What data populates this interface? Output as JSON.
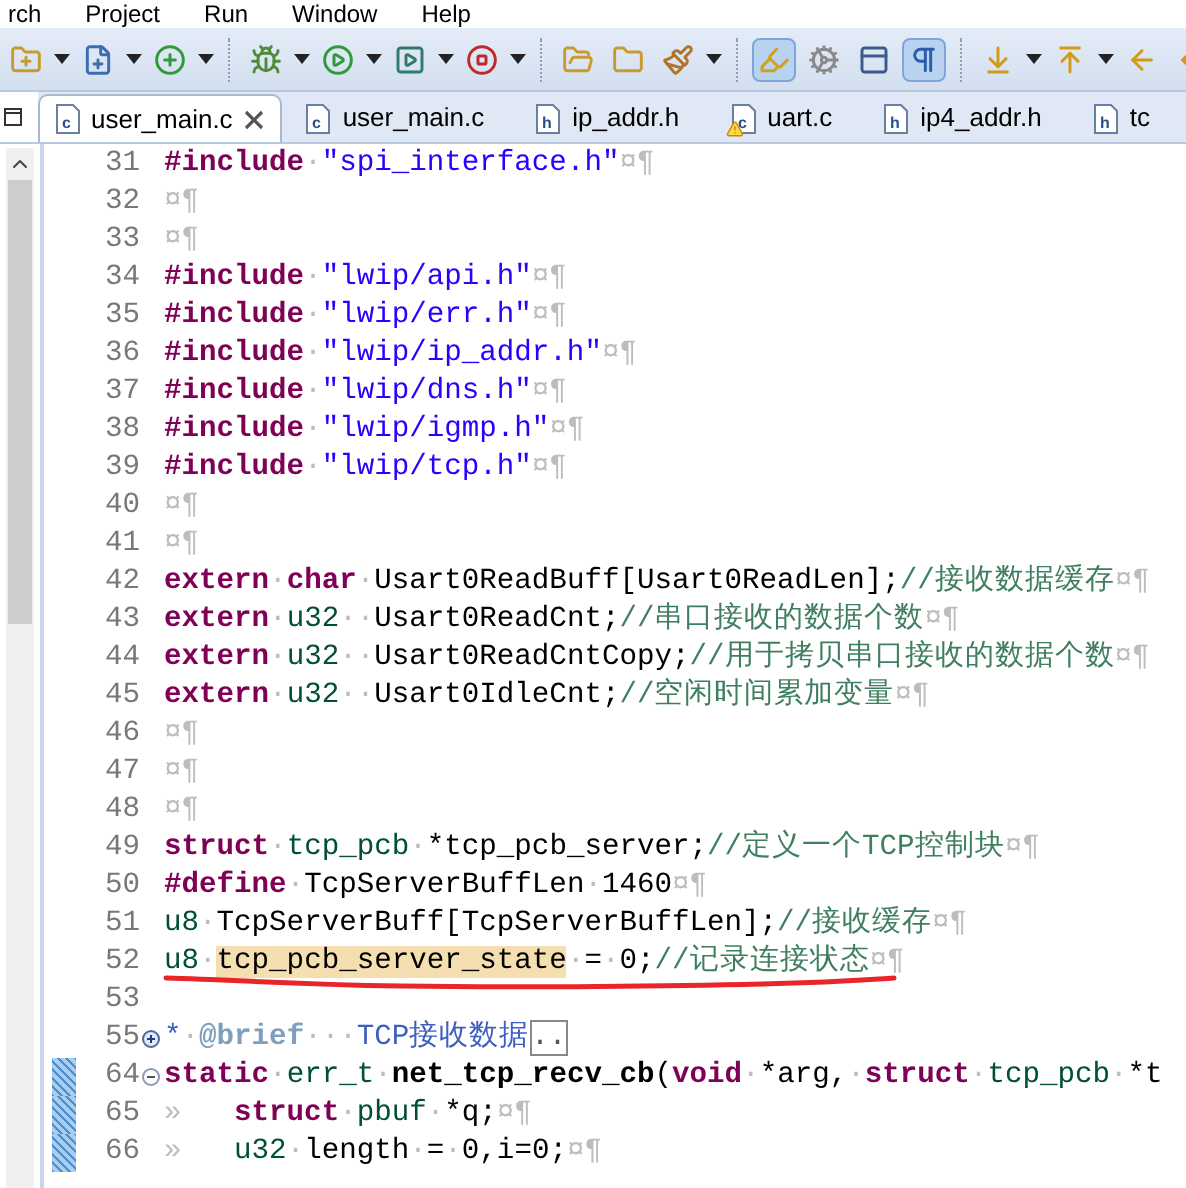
{
  "menu": [
    "rch",
    "Project",
    "Run",
    "Window",
    "Help"
  ],
  "toolbar": [
    {
      "kind": "new-folder",
      "dropdown": true,
      "pressed": false
    },
    {
      "kind": "new-file",
      "dropdown": true,
      "pressed": false
    },
    {
      "kind": "new-class",
      "dropdown": true,
      "pressed": false
    },
    {
      "kind": "separator"
    },
    {
      "kind": "debug",
      "dropdown": true,
      "pressed": false
    },
    {
      "kind": "run",
      "dropdown": true,
      "pressed": false
    },
    {
      "kind": "run-config",
      "dropdown": true,
      "pressed": false
    },
    {
      "kind": "run-stop",
      "dropdown": true,
      "pressed": false
    },
    {
      "kind": "separator"
    },
    {
      "kind": "open-folder",
      "dropdown": false,
      "pressed": false
    },
    {
      "kind": "folder",
      "dropdown": false,
      "pressed": false
    },
    {
      "kind": "brush",
      "dropdown": true,
      "pressed": false
    },
    {
      "kind": "separator"
    },
    {
      "kind": "highlighter",
      "dropdown": false,
      "pressed": true
    },
    {
      "kind": "cog",
      "dropdown": false,
      "pressed": false
    },
    {
      "kind": "panel",
      "dropdown": false,
      "pressed": false
    },
    {
      "kind": "pilcrow",
      "dropdown": false,
      "pressed": true
    },
    {
      "kind": "separator"
    },
    {
      "kind": "next",
      "dropdown": true,
      "pressed": false
    },
    {
      "kind": "prev",
      "dropdown": true,
      "pressed": false
    },
    {
      "kind": "back-star",
      "dropdown": false,
      "pressed": false
    },
    {
      "kind": "back",
      "dropdown": false,
      "pressed": false
    }
  ],
  "tabs": [
    {
      "label": "user_main.c",
      "kind": "c",
      "selected": true,
      "warning": false
    },
    {
      "label": "user_main.c",
      "kind": "c",
      "selected": false,
      "warning": false
    },
    {
      "label": "ip_addr.h",
      "kind": "h",
      "selected": false,
      "warning": false
    },
    {
      "label": "uart.c",
      "kind": "c",
      "selected": false,
      "warning": true
    },
    {
      "label": "ip4_addr.h",
      "kind": "h",
      "selected": false,
      "warning": false
    },
    {
      "label": "tc",
      "kind": "h",
      "selected": false,
      "warning": false
    }
  ],
  "lines": [
    {
      "number": "31",
      "tokens": [
        {
          "kind": "kw",
          "text": "#include"
        },
        {
          "kind": "ws",
          "text": "·"
        },
        {
          "kind": "str",
          "text": "\"spi_interface.h\""
        },
        {
          "kind": "ws",
          "text": "¤¶"
        }
      ]
    },
    {
      "number": "32",
      "tokens": [
        {
          "kind": "ws",
          "text": "¤¶"
        }
      ]
    },
    {
      "number": "33",
      "tokens": [
        {
          "kind": "ws",
          "text": "¤¶"
        }
      ]
    },
    {
      "number": "34",
      "tokens": [
        {
          "kind": "kw",
          "text": "#include"
        },
        {
          "kind": "ws",
          "text": "·"
        },
        {
          "kind": "str",
          "text": "\"lwip/api.h\""
        },
        {
          "kind": "ws",
          "text": "¤¶"
        }
      ]
    },
    {
      "number": "35",
      "tokens": [
        {
          "kind": "kw",
          "text": "#include"
        },
        {
          "kind": "ws",
          "text": "·"
        },
        {
          "kind": "str",
          "text": "\"lwip/err.h\""
        },
        {
          "kind": "ws",
          "text": "¤¶"
        }
      ]
    },
    {
      "number": "36",
      "tokens": [
        {
          "kind": "kw",
          "text": "#include"
        },
        {
          "kind": "ws",
          "text": "·"
        },
        {
          "kind": "str",
          "text": "\"lwip/ip_addr.h\""
        },
        {
          "kind": "ws",
          "text": "¤¶"
        }
      ]
    },
    {
      "number": "37",
      "tokens": [
        {
          "kind": "kw",
          "text": "#include"
        },
        {
          "kind": "ws",
          "text": "·"
        },
        {
          "kind": "str",
          "text": "\"lwip/dns.h\""
        },
        {
          "kind": "ws",
          "text": "¤¶"
        }
      ]
    },
    {
      "number": "38",
      "tokens": [
        {
          "kind": "kw",
          "text": "#include"
        },
        {
          "kind": "ws",
          "text": "·"
        },
        {
          "kind": "str",
          "text": "\"lwip/igmp.h\""
        },
        {
          "kind": "ws",
          "text": "¤¶"
        }
      ]
    },
    {
      "number": "39",
      "tokens": [
        {
          "kind": "kw",
          "text": "#include"
        },
        {
          "kind": "ws",
          "text": "·"
        },
        {
          "kind": "str",
          "text": "\"lwip/tcp.h\""
        },
        {
          "kind": "ws",
          "text": "¤¶"
        }
      ]
    },
    {
      "number": "40",
      "tokens": [
        {
          "kind": "ws",
          "text": "¤¶"
        }
      ]
    },
    {
      "number": "41",
      "tokens": [
        {
          "kind": "ws",
          "text": "¤¶"
        }
      ]
    },
    {
      "number": "42",
      "tokens": [
        {
          "kind": "kw",
          "text": "extern"
        },
        {
          "kind": "ws",
          "text": "·"
        },
        {
          "kind": "kw",
          "text": "char"
        },
        {
          "kind": "ws",
          "text": "·"
        },
        {
          "kind": "plain",
          "text": "Usart0ReadBuff[Usart0ReadLen];"
        },
        {
          "kind": "cmt",
          "text": "//接收数据缓存"
        },
        {
          "kind": "ws",
          "text": "¤¶"
        }
      ]
    },
    {
      "number": "43",
      "tokens": [
        {
          "kind": "kw",
          "text": "extern"
        },
        {
          "kind": "ws",
          "text": "·"
        },
        {
          "kind": "type",
          "text": "u32"
        },
        {
          "kind": "ws",
          "text": "··"
        },
        {
          "kind": "plain",
          "text": "Usart0ReadCnt;"
        },
        {
          "kind": "cmt",
          "text": "//串口接收的数据个数"
        },
        {
          "kind": "ws",
          "text": "¤¶"
        }
      ]
    },
    {
      "number": "44",
      "tokens": [
        {
          "kind": "kw",
          "text": "extern"
        },
        {
          "kind": "ws",
          "text": "·"
        },
        {
          "kind": "type",
          "text": "u32"
        },
        {
          "kind": "ws",
          "text": "··"
        },
        {
          "kind": "plain",
          "text": "Usart0ReadCntCopy;"
        },
        {
          "kind": "cmt",
          "text": "//用于拷贝串口接收的数据个数"
        },
        {
          "kind": "ws",
          "text": "¤¶"
        }
      ]
    },
    {
      "number": "45",
      "tokens": [
        {
          "kind": "kw",
          "text": "extern"
        },
        {
          "kind": "ws",
          "text": "·"
        },
        {
          "kind": "type",
          "text": "u32"
        },
        {
          "kind": "ws",
          "text": "··"
        },
        {
          "kind": "plain",
          "text": "Usart0IdleCnt;"
        },
        {
          "kind": "cmt",
          "text": "//空闲时间累加变量"
        },
        {
          "kind": "ws",
          "text": "¤¶"
        }
      ]
    },
    {
      "number": "46",
      "tokens": [
        {
          "kind": "ws",
          "text": "¤¶"
        }
      ]
    },
    {
      "number": "47",
      "tokens": [
        {
          "kind": "ws",
          "text": "¤¶"
        }
      ]
    },
    {
      "number": "48",
      "tokens": [
        {
          "kind": "ws",
          "text": "¤¶"
        }
      ]
    },
    {
      "number": "49",
      "tokens": [
        {
          "kind": "kw",
          "text": "struct"
        },
        {
          "kind": "ws",
          "text": "·"
        },
        {
          "kind": "type",
          "text": "tcp_pcb"
        },
        {
          "kind": "ws",
          "text": "·"
        },
        {
          "kind": "plain",
          "text": "*tcp_pcb_server;"
        },
        {
          "kind": "cmt",
          "text": "//定义一个TCP控制块"
        },
        {
          "kind": "ws",
          "text": "¤¶"
        }
      ]
    },
    {
      "number": "50",
      "tokens": [
        {
          "kind": "kw",
          "text": "#define"
        },
        {
          "kind": "ws",
          "text": "·"
        },
        {
          "kind": "plain",
          "text": "TcpServerBuffLen"
        },
        {
          "kind": "ws",
          "text": "·"
        },
        {
          "kind": "plain",
          "text": "1460"
        },
        {
          "kind": "ws",
          "text": "¤¶"
        }
      ]
    },
    {
      "number": "51",
      "tokens": [
        {
          "kind": "type",
          "text": "u8"
        },
        {
          "kind": "ws",
          "text": "·"
        },
        {
          "kind": "plain",
          "text": "TcpServerBuff[TcpServerBuffLen];"
        },
        {
          "kind": "cmt",
          "text": "//接收缓存"
        },
        {
          "kind": "ws",
          "text": "¤¶"
        }
      ]
    },
    {
      "number": "52",
      "underlined": true,
      "tokens": [
        {
          "kind": "type",
          "text": "u8"
        },
        {
          "kind": "ws",
          "text": "·"
        },
        {
          "kind": "hl",
          "text": "tcp_pcb_server_state"
        },
        {
          "kind": "ws",
          "text": "·"
        },
        {
          "kind": "plain",
          "text": "="
        },
        {
          "kind": "ws",
          "text": "·"
        },
        {
          "kind": "plain",
          "text": "0;"
        },
        {
          "kind": "cmt",
          "text": "//记录连接状态"
        },
        {
          "kind": "ws",
          "text": "¤¶"
        }
      ]
    },
    {
      "number": "53"
    },
    {
      "number": "55",
      "collapsed": true,
      "tokens": [
        {
          "kind": "doc",
          "text": "*"
        },
        {
          "kind": "ws",
          "text": "·"
        },
        {
          "kind": "tag",
          "text": "@brief"
        },
        {
          "kind": "ws",
          "text": "···"
        },
        {
          "kind": "doc",
          "text": "TCP接收数据"
        },
        {
          "kind": "more",
          "text": ".."
        }
      ]
    },
    {
      "number": "64",
      "collapsed": false,
      "changed": true,
      "tokens": [
        {
          "kind": "kw",
          "text": "static"
        },
        {
          "kind": "ws",
          "text": "·"
        },
        {
          "kind": "type",
          "text": "err_t"
        },
        {
          "kind": "ws",
          "text": "·"
        },
        {
          "kind": "fn",
          "text": "net_tcp_recv_cb"
        },
        {
          "kind": "plain",
          "text": "("
        },
        {
          "kind": "kw",
          "text": "void"
        },
        {
          "kind": "ws",
          "text": "·"
        },
        {
          "kind": "plain",
          "text": "*arg,"
        },
        {
          "kind": "ws",
          "text": "·"
        },
        {
          "kind": "kw",
          "text": "struct"
        },
        {
          "kind": "ws",
          "text": "·"
        },
        {
          "kind": "type",
          "text": "tcp_pcb"
        },
        {
          "kind": "ws",
          "text": "·"
        },
        {
          "kind": "plain",
          "text": "*t"
        }
      ]
    },
    {
      "number": "65",
      "changed": true,
      "tokens": [
        {
          "kind": "ws",
          "text": "»   "
        },
        {
          "kind": "kw",
          "text": "struct"
        },
        {
          "kind": "ws",
          "text": "·"
        },
        {
          "kind": "type",
          "text": "pbuf"
        },
        {
          "kind": "ws",
          "text": "·"
        },
        {
          "kind": "plain",
          "text": "*q;"
        },
        {
          "kind": "ws",
          "text": "¤¶"
        }
      ]
    },
    {
      "number": "66",
      "changed": true,
      "tokens": [
        {
          "kind": "ws",
          "text": "»   "
        },
        {
          "kind": "type",
          "text": "u32"
        },
        {
          "kind": "ws",
          "text": "·"
        },
        {
          "kind": "plain",
          "text": "length"
        },
        {
          "kind": "ws",
          "text": "·"
        },
        {
          "kind": "plain",
          "text": "="
        },
        {
          "kind": "ws",
          "text": "·"
        },
        {
          "kind": "plain",
          "text": "0,i=0;"
        },
        {
          "kind": "ws",
          "text": "¤¶"
        }
      ]
    }
  ]
}
